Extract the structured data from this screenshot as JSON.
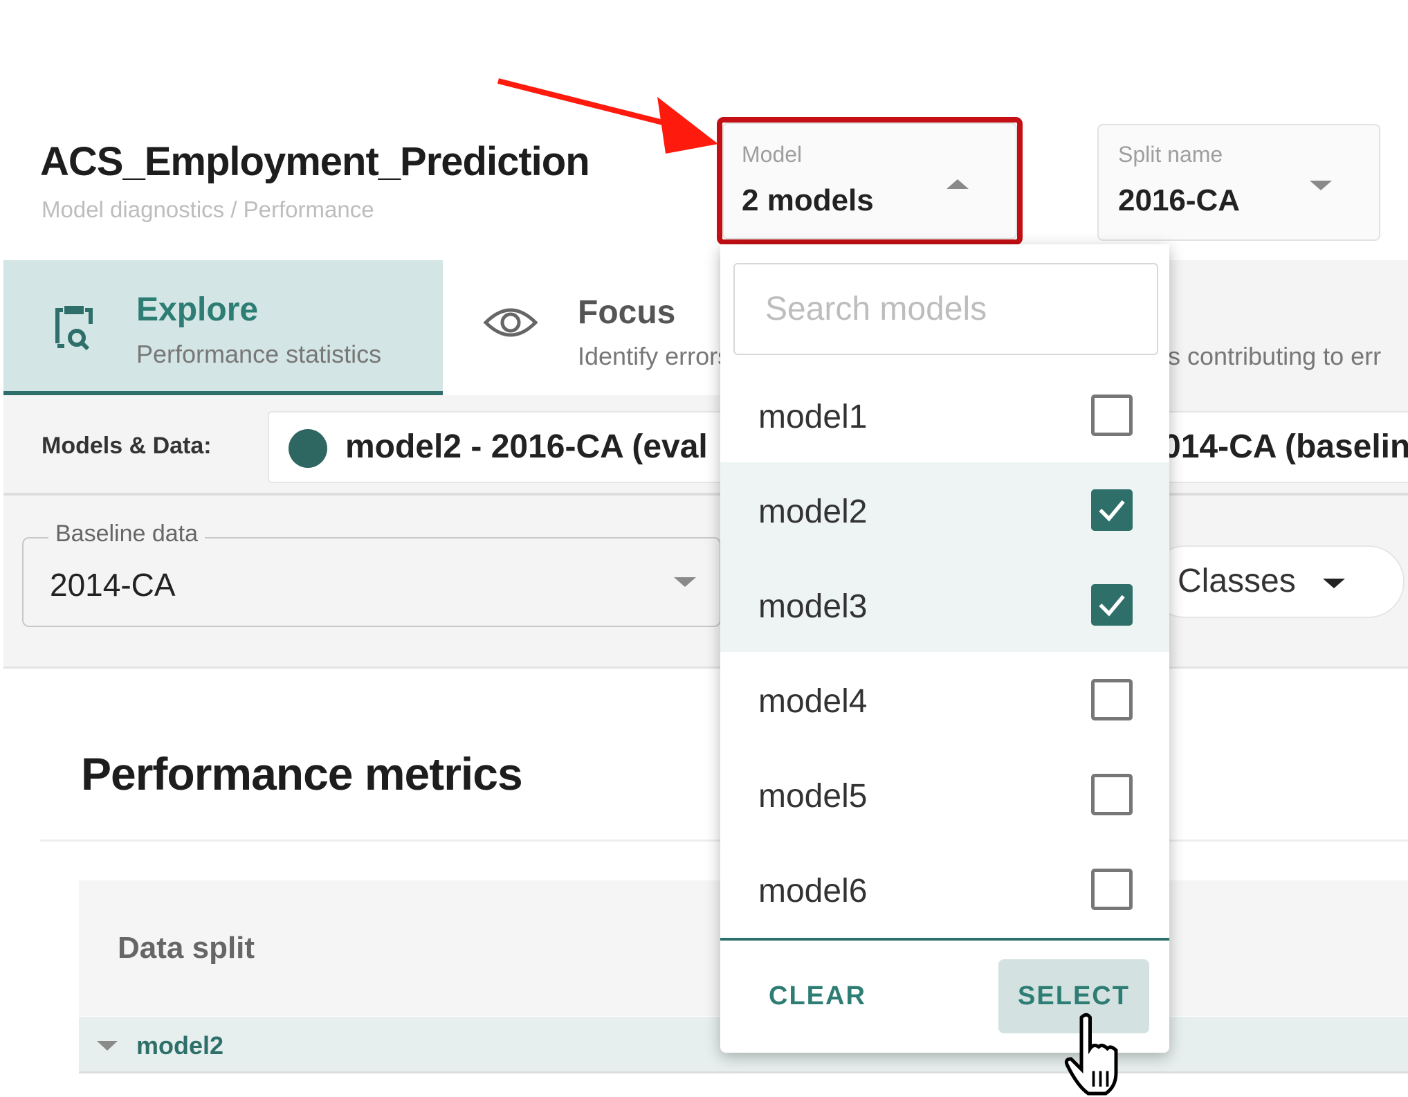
{
  "header": {
    "title": "ACS_Employment_Prediction",
    "breadcrumb": "Model diagnostics / Performance"
  },
  "model_select": {
    "label": "Model",
    "value": "2 models",
    "icon": "caret-up-icon"
  },
  "split_select": {
    "label": "Split name",
    "value": "2016-CA",
    "icon": "caret-down-icon"
  },
  "tabs": [
    {
      "title": "Explore",
      "subtitle": "Performance statistics",
      "icon": "clipboard-search-icon",
      "active": true
    },
    {
      "title": "Focus",
      "subtitle": "Identify errors",
      "icon": "eye-icon"
    },
    {
      "subtitle": "s contributing to err"
    }
  ],
  "models_data": {
    "label": "Models & Data:",
    "chips": [
      "model2 - 2016-CA (eval",
      "014-CA (baselin"
    ],
    "color": "#2e6661"
  },
  "baseline": {
    "label": "Baseline data",
    "value": "2014-CA"
  },
  "classes": {
    "label": "Classes"
  },
  "card": {
    "title": "Performance metrics",
    "column": "Data split",
    "row": "model2"
  },
  "dropdown": {
    "search_placeholder": "Search models",
    "items": [
      {
        "label": "model1",
        "checked": false
      },
      {
        "label": "model2",
        "checked": true
      },
      {
        "label": "model3",
        "checked": true
      },
      {
        "label": "model4",
        "checked": false
      },
      {
        "label": "model5",
        "checked": false
      },
      {
        "label": "model6",
        "checked": false
      }
    ],
    "clear": "CLEAR",
    "select": "SELECT"
  },
  "colors": {
    "accent": "#2e6f6a",
    "highlight": "#c40f14",
    "arrow": "#ff1a0e"
  }
}
